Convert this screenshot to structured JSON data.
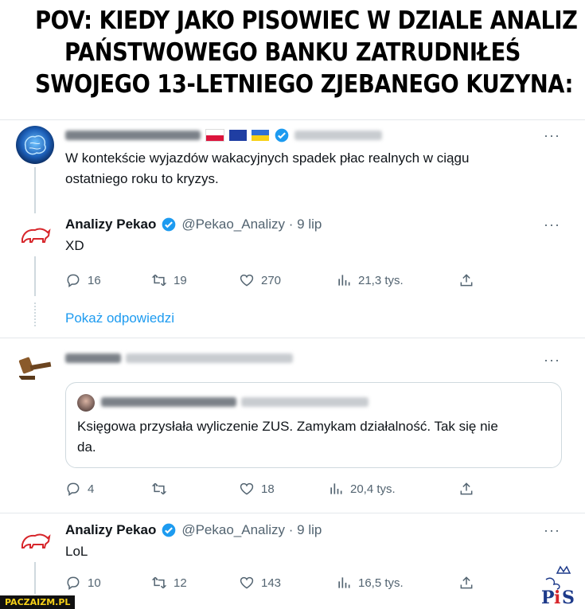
{
  "caption": {
    "line1": "POV: KIEDY JAKO PISOWIEC W DZIALE ANALIZ",
    "line2": "PAŃSTWOWEGO BANKU ZATRUDNIŁEŚ",
    "line3": "SWOJEGO 13-LETNIEGO ZJEBANEGO KUZYNA:"
  },
  "tweets": [
    {
      "text_l1": "W kontekście wyjazdów wakacyjnych spadek płac realnych w ciągu",
      "text_l2": "ostatniego roku to kryzys.",
      "avatar_icon": "globe-brain-icon"
    },
    {
      "name": "Analizy Pekao",
      "handle": "@Pekao_Analizy · 9 lip",
      "text": "XD",
      "replies": "16",
      "retweets": "19",
      "likes": "270",
      "views": "21,3 tys.",
      "show_replies": "Pokaż odpowiedzi"
    },
    {
      "quote_text_l1": "Księgowa przysłała wyliczenie ZUS.  Zamykam działalność. Tak się nie",
      "quote_text_l2": "da.",
      "replies": "4",
      "retweets": "",
      "likes": "18",
      "views": "20,4 tys."
    },
    {
      "name": "Analizy Pekao",
      "handle": "@Pekao_Analizy · 9 lip",
      "text": "LoL",
      "replies": "10",
      "retweets": "12",
      "likes": "143",
      "views": "16,5 tys."
    }
  ],
  "more_glyph": "···",
  "watermark": "PACZAIZM.PL",
  "logo": {
    "text": "PiS"
  },
  "colors": {
    "link": "#1d9bf0",
    "verified": "#1d9bf0",
    "muted": "#536471",
    "pekao_red": "#d7262b"
  }
}
